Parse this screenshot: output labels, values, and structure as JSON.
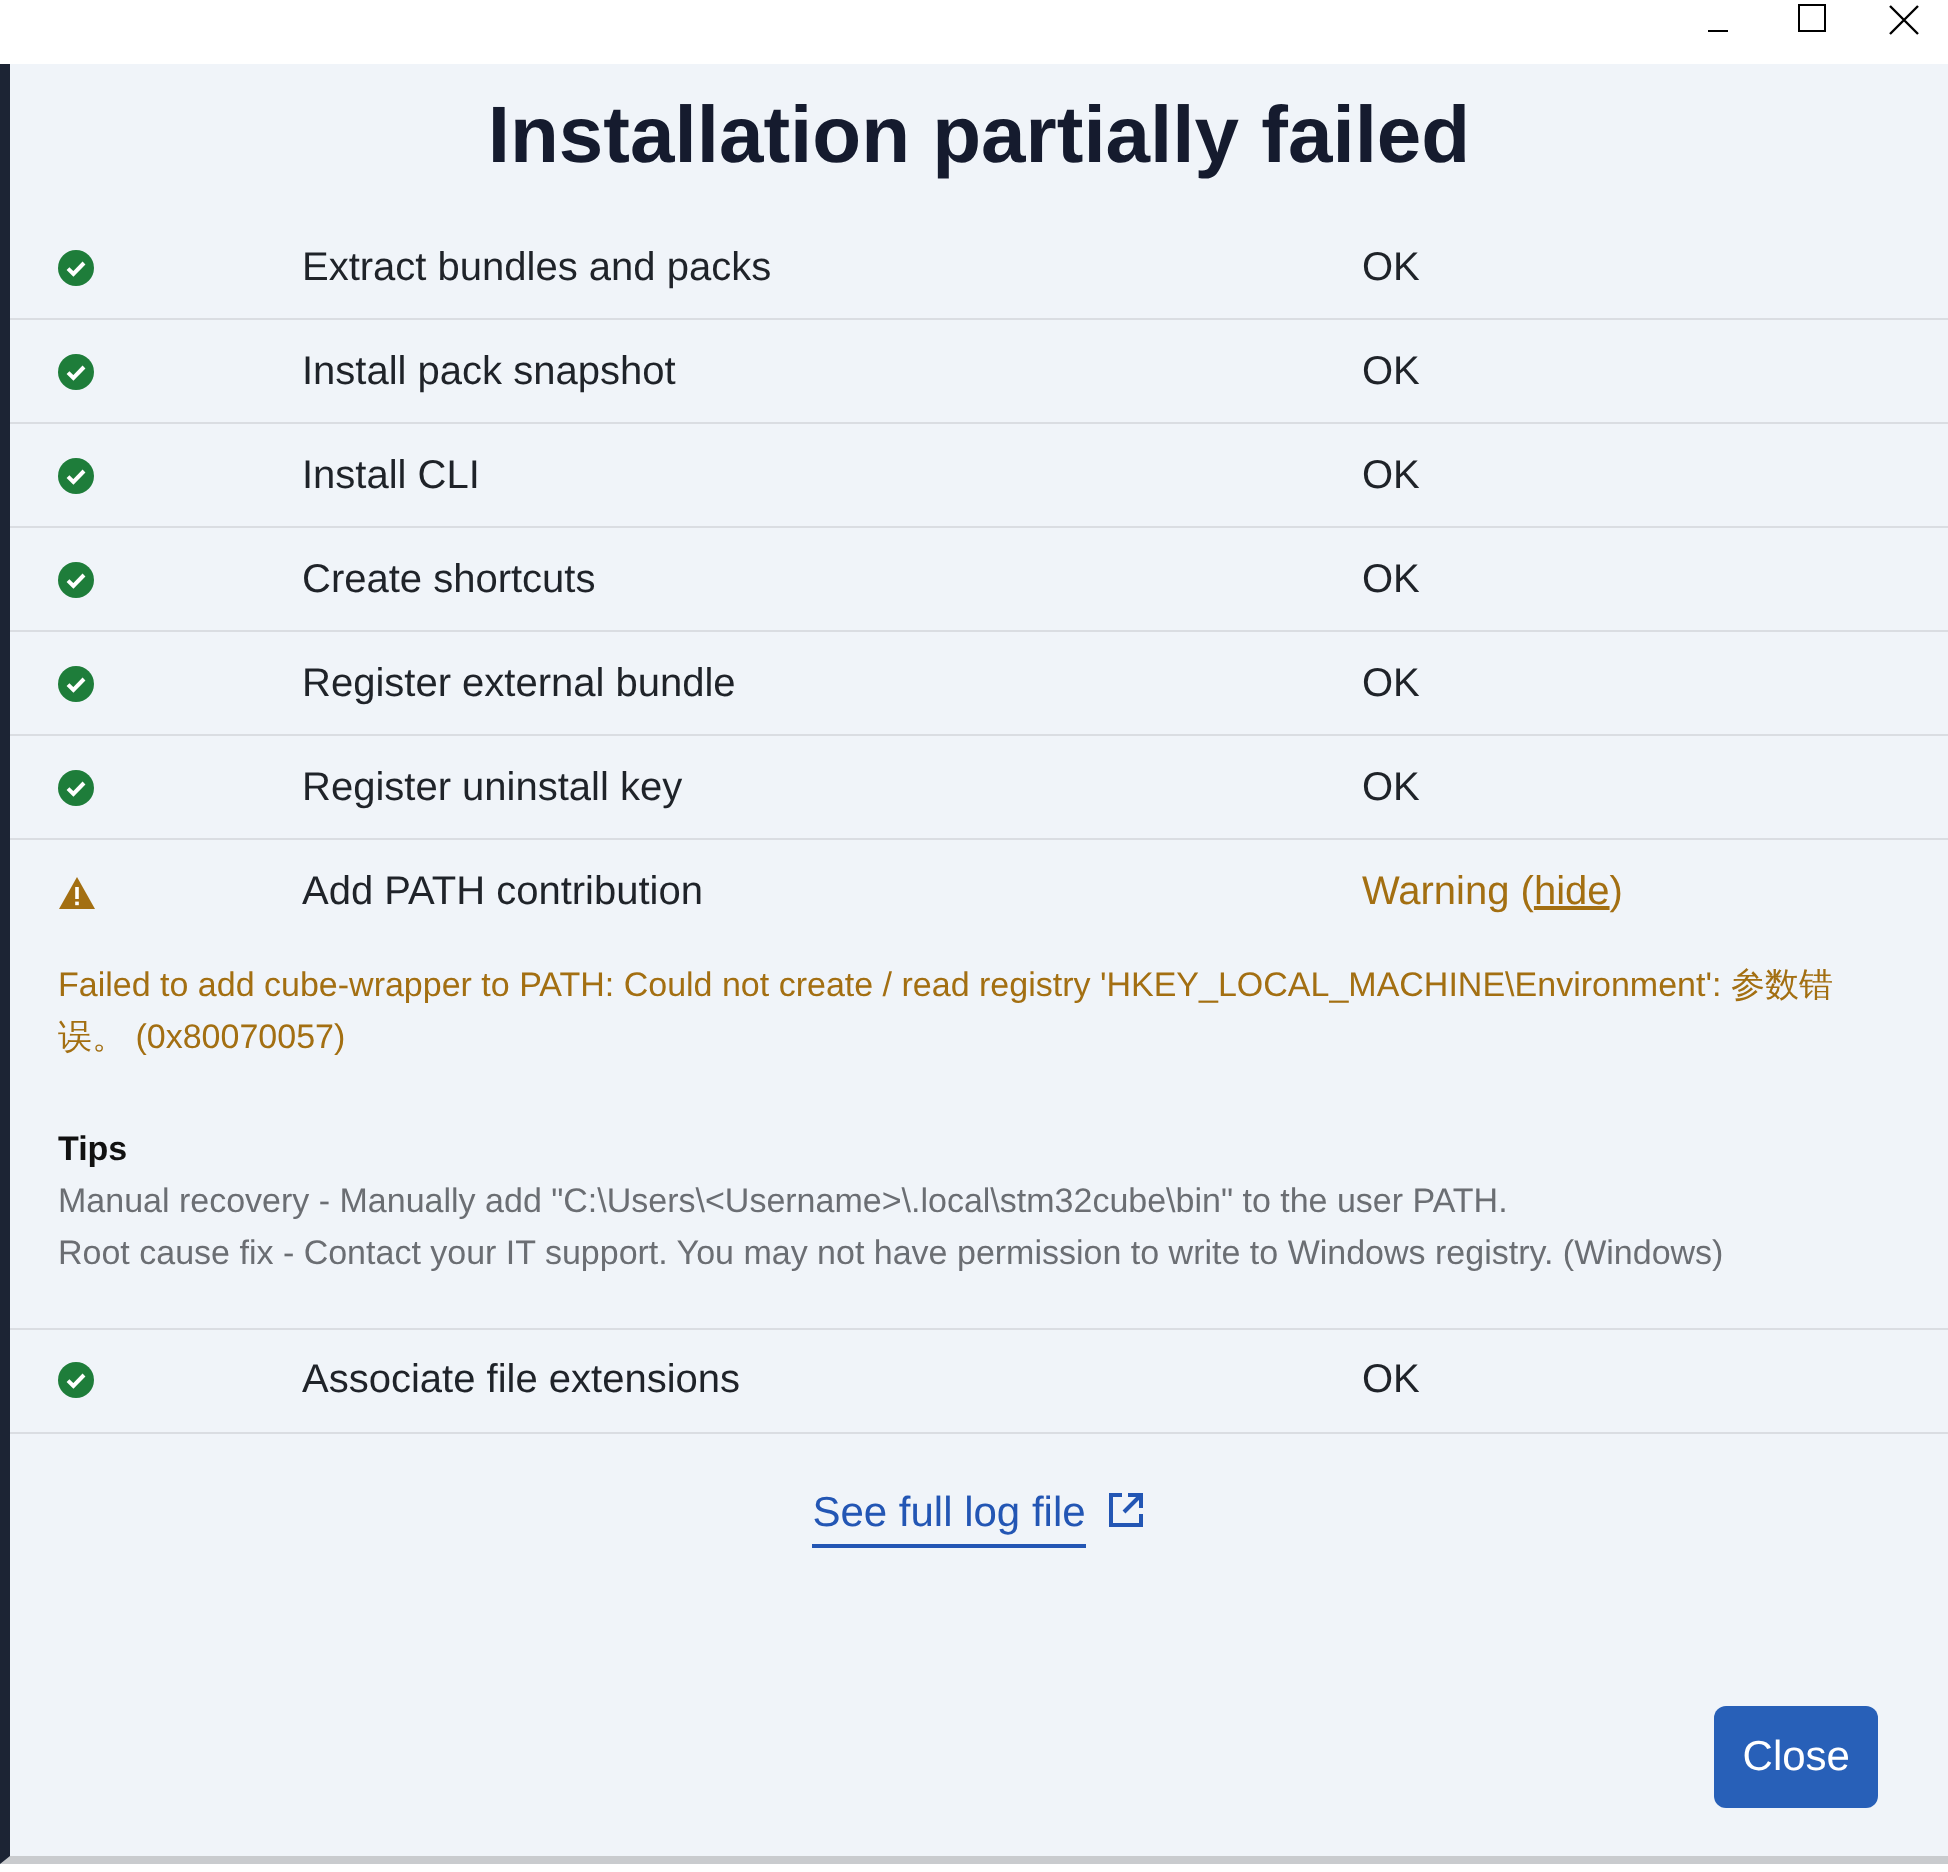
{
  "title": "Installation partially failed",
  "steps": [
    {
      "kind": "ok",
      "label": "Extract bundles and packs",
      "status": "OK"
    },
    {
      "kind": "ok",
      "label": "Install pack snapshot",
      "status": "OK"
    },
    {
      "kind": "ok",
      "label": "Install CLI",
      "status": "OK"
    },
    {
      "kind": "ok",
      "label": "Create shortcuts",
      "status": "OK"
    },
    {
      "kind": "ok",
      "label": "Register external bundle",
      "status": "OK"
    },
    {
      "kind": "ok",
      "label": "Register uninstall key",
      "status": "OK"
    },
    {
      "kind": "warning",
      "label": "Add PATH contribution",
      "status": "Warning (",
      "toggle": "hide",
      "status_end": ")",
      "expanded": true,
      "message": "Failed to add cube-wrapper to PATH: Could not create / read registry 'HKEY_LOCAL_MACHINE\\Environment': 参数错误。 (0x80070057)",
      "tips_title": "Tips",
      "tips": [
        "Manual recovery - Manually add \"C:\\Users\\<Username>\\.local\\stm32cube\\bin\" to the user PATH.",
        "Root cause fix - Contact your IT support. You may not have permission to write to Windows registry. (Windows)"
      ]
    },
    {
      "kind": "ok",
      "label": "Associate file extensions",
      "status": "OK"
    }
  ],
  "log_link": "See full log file",
  "close_button": "Close"
}
